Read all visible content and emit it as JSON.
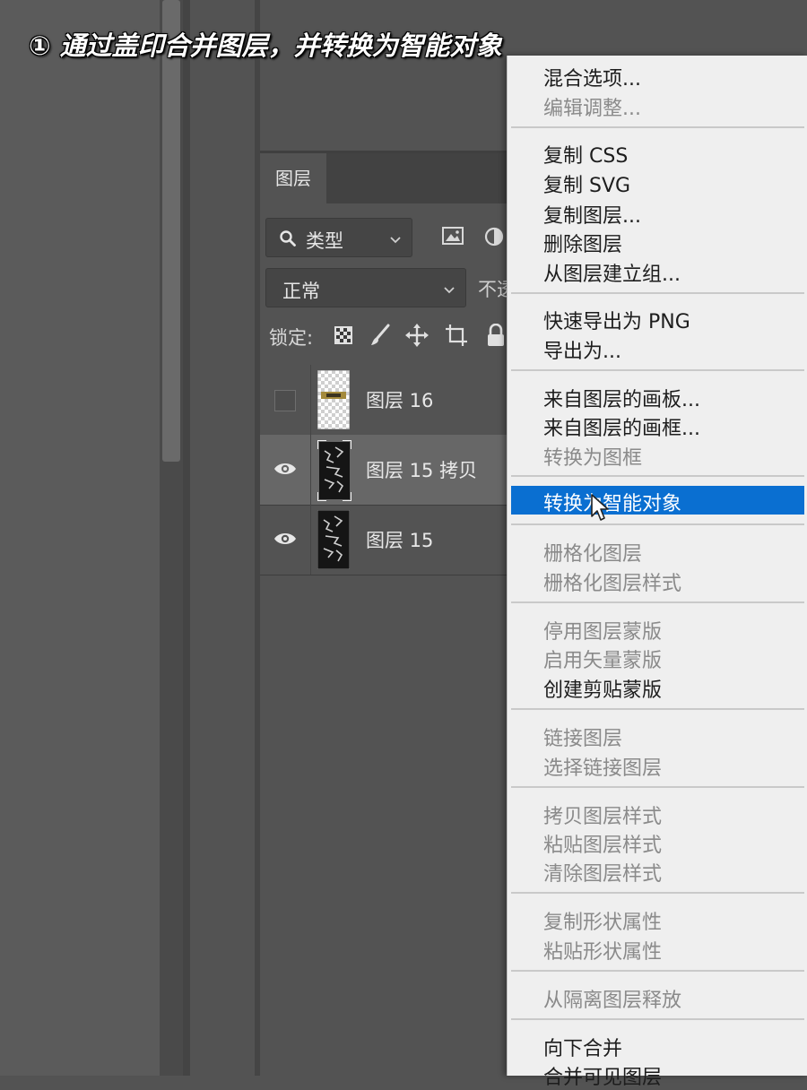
{
  "caption": "① 通过盖印合并图层，并转换为智能对象",
  "layers_panel": {
    "tab_label": "图层",
    "filter": {
      "label": "类型",
      "icon": "search-icon"
    },
    "blend_mode": "正常",
    "opacity_label": "不透",
    "lock_label": "锁定:",
    "layers": [
      {
        "name": "图层 16",
        "visible": false,
        "selected": false
      },
      {
        "name": "图层 15 拷贝",
        "visible": true,
        "selected": true
      },
      {
        "name": "图层 15",
        "visible": true,
        "selected": false
      }
    ]
  },
  "context_menu": {
    "items": [
      {
        "label": "混合选项...",
        "enabled": true
      },
      {
        "label": "编辑调整...",
        "enabled": false
      },
      {
        "label": "复制 CSS",
        "enabled": true
      },
      {
        "label": "复制 SVG",
        "enabled": true
      },
      {
        "label": "复制图层...",
        "enabled": true
      },
      {
        "label": "删除图层",
        "enabled": true
      },
      {
        "label": "从图层建立组...",
        "enabled": true
      },
      {
        "label": "快速导出为 PNG",
        "enabled": true
      },
      {
        "label": "导出为...",
        "enabled": true
      },
      {
        "label": "来自图层的画板...",
        "enabled": true
      },
      {
        "label": "来自图层的画框...",
        "enabled": true
      },
      {
        "label": "转换为图框",
        "enabled": false
      },
      {
        "label": "转换为智能对象",
        "enabled": true,
        "highlighted": true
      },
      {
        "label": "栅格化图层",
        "enabled": false
      },
      {
        "label": "栅格化图层样式",
        "enabled": false
      },
      {
        "label": "停用图层蒙版",
        "enabled": false
      },
      {
        "label": "启用矢量蒙版",
        "enabled": false
      },
      {
        "label": "创建剪贴蒙版",
        "enabled": true
      },
      {
        "label": "链接图层",
        "enabled": false
      },
      {
        "label": "选择链接图层",
        "enabled": false
      },
      {
        "label": "拷贝图层样式",
        "enabled": false
      },
      {
        "label": "粘贴图层样式",
        "enabled": false
      },
      {
        "label": "清除图层样式",
        "enabled": false
      },
      {
        "label": "复制形状属性",
        "enabled": false
      },
      {
        "label": "粘贴形状属性",
        "enabled": false
      },
      {
        "label": "从隔离图层释放",
        "enabled": false
      },
      {
        "label": "向下合并",
        "enabled": true
      },
      {
        "label": "合并可见图层",
        "enabled": true
      }
    ]
  },
  "colors": {
    "menu_highlight": "#0a6fd1",
    "menu_bg": "#efefef",
    "panel_bg": "#535353",
    "selected_row": "#676767"
  }
}
